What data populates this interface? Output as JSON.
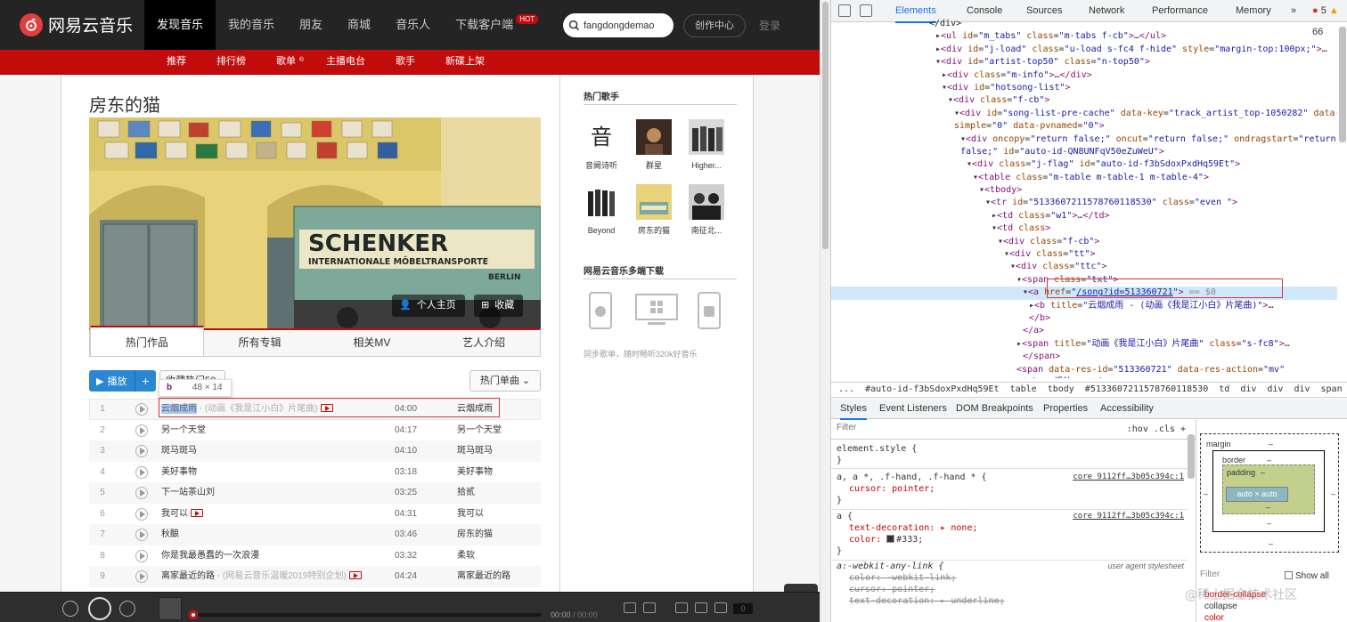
{
  "site": {
    "logo_text": "网易云音乐",
    "nav": [
      "发现音乐",
      "我的音乐",
      "朋友",
      "商城",
      "音乐人",
      "下载客户端"
    ],
    "hot_badge": "HOT",
    "search_value": "fangdongdemao",
    "creator_label": "创作中心",
    "login_label": "登录",
    "subnav": [
      "推荐",
      "排行榜",
      "歌单",
      "主播电台",
      "歌手",
      "新碟上架"
    ],
    "subnav_mark": "®"
  },
  "artist": {
    "name": "房东的猫",
    "banner_sign_line1": "SCHENKER",
    "banner_sign_line2": "INTERNATIONALE MÖBELTRANSPORTE",
    "banner_sign_line3": "BERLIN",
    "homepage_label": "个人主页",
    "collect_label": "收藏",
    "tabs": [
      "热门作品",
      "所有专辑",
      "相关MV",
      "艺人介绍"
    ],
    "play_label": "播放",
    "add_label": "+",
    "fav_label": "收藏热门50",
    "tooltip_tag": "b",
    "tooltip_dims": "48 × 14",
    "hot_select_label": "热门单曲"
  },
  "songs": [
    {
      "num": "1",
      "title": "云烟成雨",
      "alias": " - (动画《我是江小白》片尾曲)",
      "mv": true,
      "duration": "04:00",
      "album": "云烟成雨"
    },
    {
      "num": "2",
      "title": "另一个天堂",
      "alias": "",
      "mv": false,
      "duration": "04:17",
      "album": "另一个天堂"
    },
    {
      "num": "3",
      "title": "斑马斑马",
      "alias": "",
      "mv": false,
      "duration": "04:10",
      "album": "斑马斑马"
    },
    {
      "num": "4",
      "title": "美好事物",
      "alias": "",
      "mv": false,
      "duration": "03:18",
      "album": "美好事物"
    },
    {
      "num": "5",
      "title": "下一站茶山刘",
      "alias": "",
      "mv": false,
      "duration": "03:25",
      "album": "拾贰"
    },
    {
      "num": "6",
      "title": "我可以",
      "alias": "",
      "mv": true,
      "duration": "04:31",
      "album": "我可以"
    },
    {
      "num": "7",
      "title": "秋酿",
      "alias": "",
      "mv": false,
      "duration": "03:46",
      "album": "房东的猫"
    },
    {
      "num": "8",
      "title": "你是我最愚蠢的一次浪漫",
      "alias": "",
      "mv": false,
      "duration": "03:32",
      "album": "柔软"
    },
    {
      "num": "9",
      "title": "离家最近的路",
      "alias": " - (网易云音乐温暖2019特别企划)",
      "mv": true,
      "duration": "04:24",
      "album": "离家最近的路"
    }
  ],
  "sidebar": {
    "hot_artists_title": "热门歌手",
    "artists": [
      "音阙诗听",
      "群星",
      "Higher...",
      "Beyond",
      "房东的猫",
      "南征北..."
    ],
    "download_title": "网易云音乐多端下载",
    "download_desc": "同步歌单，随时畅听320k好音乐"
  },
  "player": {
    "time_current": "00:00",
    "time_total": "00:00",
    "playlist_count": "0"
  },
  "devtools": {
    "tabs": [
      "Elements",
      "Console",
      "Sources",
      "Network",
      "Performance",
      "Memory"
    ],
    "more": "»",
    "errors": "5",
    "warnings": "66",
    "dom_lines": [
      {
        "indent": 0,
        "html": "<span class='c'>&lt;/div&gt;</span>"
      },
      {
        "indent": 1,
        "html": "▸<span class='t'>&lt;ul</span> <span class='a'>id</span>=<span class='v'>\"m_tabs\"</span> <span class='a'>class</span>=<span class='v'>\"m-tabs f-cb\"</span><span class='t'>&gt;</span>…<span class='t'>&lt;/ul&gt;</span>"
      },
      {
        "indent": 1,
        "html": "▸<span class='t'>&lt;div</span> <span class='a'>id</span>=<span class='v'>\"j-load\"</span> <span class='a'>class</span>=<span class='v'>\"u-load s-fc4 f-hide\"</span> <span class='a'>style</span>=<span class='v'>\"margin-top:100px;\"</span><span class='t'>&gt;</span>…"
      },
      {
        "indent": 1,
        "html": "▾<span class='t'>&lt;div</span> <span class='a'>id</span>=<span class='v'>\"artist-top50\"</span> <span class='a'>class</span>=<span class='v'>\"n-top50\"</span><span class='t'>&gt;</span>"
      },
      {
        "indent": 2,
        "html": "▸<span class='t'>&lt;div</span> <span class='a'>class</span>=<span class='v'>\"m-info\"</span><span class='t'>&gt;</span>…<span class='t'>&lt;/div&gt;</span>"
      },
      {
        "indent": 2,
        "html": "▾<span class='t'>&lt;div</span> <span class='a'>id</span>=<span class='v'>\"hotsong-list\"</span><span class='t'>&gt;</span>"
      },
      {
        "indent": 3,
        "html": "▾<span class='t'>&lt;div</span> <span class='a'>class</span>=<span class='v'>\"f-cb\"</span><span class='t'>&gt;</span>"
      },
      {
        "indent": 4,
        "html": "▾<span class='t'>&lt;div</span> <span class='a'>id</span>=<span class='v'>\"song-list-pre-cache\"</span> <span class='a'>data-key</span>=<span class='v'>\"track_artist_top-1050282\"</span> <span class='a'>data-</span>"
      },
      {
        "indent": 4,
        "html": "<span class='a'>simple</span>=<span class='v'>\"0\"</span> <span class='a'>data-pvnamed</span>=<span class='v'>\"0\"</span><span class='t'>&gt;</span>"
      },
      {
        "indent": 5,
        "html": "▾<span class='t'>&lt;div</span> <span class='a'>oncopy</span>=<span class='v'>\"return false;\"</span> <span class='a'>oncut</span>=<span class='v'>\"return false;\"</span> <span class='a'>ondragstart</span>=<span class='v'>\"return</span>"
      },
      {
        "indent": 5,
        "html": "<span class='v'>false;\"</span> <span class='a'>id</span>=<span class='v'>\"auto-id-QN8UNFqV50eZuWeU\"</span><span class='t'>&gt;</span>"
      },
      {
        "indent": 6,
        "html": "▾<span class='t'>&lt;div</span> <span class='a'>class</span>=<span class='v'>\"j-flag\"</span> <span class='a'>id</span>=<span class='v'>\"auto-id-f3bSdoxPxdHq59Et\"</span><span class='t'>&gt;</span>"
      },
      {
        "indent": 7,
        "html": "▾<span class='t'>&lt;table</span> <span class='a'>class</span>=<span class='v'>\"m-table m-table-1 m-table-4\"</span><span class='t'>&gt;</span>"
      },
      {
        "indent": 8,
        "html": "▾<span class='t'>&lt;tbody&gt;</span>"
      },
      {
        "indent": 9,
        "html": "▾<span class='t'>&lt;tr</span> <span class='a'>id</span>=<span class='v'>\"5133607211578760118530\"</span> <span class='a'>class</span>=<span class='v'>\"even \"</span><span class='t'>&gt;</span>"
      },
      {
        "indent": 10,
        "html": "▸<span class='t'>&lt;td</span> <span class='a'>class</span>=<span class='v'>\"w1\"</span><span class='t'>&gt;</span>…<span class='t'>&lt;/td&gt;</span>"
      },
      {
        "indent": 10,
        "html": "▾<span class='t'>&lt;td</span> <span class='a'>class</span><span class='t'>&gt;</span>"
      },
      {
        "indent": 11,
        "html": "▾<span class='t'>&lt;div</span> <span class='a'>class</span>=<span class='v'>\"f-cb\"</span><span class='t'>&gt;</span>"
      },
      {
        "indent": 12,
        "html": "▾<span class='t'>&lt;div</span> <span class='a'>class</span>=<span class='v'>\"tt\"</span><span class='t'>&gt;</span>"
      },
      {
        "indent": 13,
        "html": "▾<span class='t'>&lt;div</span> <span class='a'>class</span>=<span class='v'>\"ttc\"</span><span class='t'>&gt;</span>"
      },
      {
        "indent": 14,
        "html": "▾<span class='t'>&lt;span</span> <span class='a'>class</span>=<span class='v'>\"txt\"</span><span class='t'>&gt;</span>"
      },
      {
        "indent": 15,
        "sel": true,
        "html": "▾<span class='t'>&lt;a</span> <span class='a'>href</span>=<span class='v'>\"</span><span class='lnk'>/song?id=513360721</span><span class='v'>\"</span><span class='t'>&gt;</span> <span class='dim'>== $0</span>"
      },
      {
        "indent": 16,
        "html": "▸<span class='t'>&lt;b</span> <span class='a'>title</span>=<span class='v'>\"云烟成雨 - (动画《我是江小白》片尾曲)\"</span><span class='t'>&gt;</span>…"
      },
      {
        "indent": 16,
        "html": "<span class='t'>&lt;/b&gt;</span>"
      },
      {
        "indent": 15,
        "html": "<span class='t'>&lt;/a&gt;</span>"
      },
      {
        "indent": 14,
        "html": "▸<span class='t'>&lt;span</span> <span class='a'>title</span>=<span class='v'>\"动画《我是江小白》片尾曲\"</span> <span class='a'>class</span>=<span class='v'>\"s-fc8\"</span><span class='t'>&gt;</span>…"
      },
      {
        "indent": 15,
        "html": "<span class='t'>&lt;/span&gt;</span>"
      },
      {
        "indent": 14,
        "html": "<span class='t'>&lt;span</span> <span class='a'>data-res-id</span>=<span class='v'>\"513360721\"</span> <span class='a'>data-res-action</span>=<span class='v'>\"mv\"</span>"
      },
      {
        "indent": 14,
        "html": "<span class='a'>title</span>=<span class='v'>\"播放mv\"</span> <span class='a'>class</span>=<span class='v'>\"mv\"</span><span class='t'>&gt;</span>MV<span class='t'>&lt;/span&gt;</span>"
      }
    ],
    "dom_gutter": "...",
    "breadcrumbs": [
      "...",
      "#auto-id-f3bSdoxPxdHq59Et",
      "table",
      "tbody",
      "#5133607211578760118530",
      "td",
      "div",
      "div",
      "div",
      "span",
      "a"
    ],
    "sub_tabs": [
      "Styles",
      "Event Listeners",
      "DOM Breakpoints",
      "Properties",
      "Accessibility"
    ],
    "filter_placeholder": "Filter",
    "filter_tools": ":hov  .cls  +",
    "rules": {
      "element_style": "element.style {",
      "close": "}",
      "r1_sel": "a, a *, .f-hand, .f-hand * {",
      "r1_src": "core_9112ff…3b05c394c:1",
      "r1_prop": "cursor: pointer;",
      "r2_sel": "a {",
      "r2_src": "core_9112ff…3b05c394c:1",
      "r2_p1": "text-decoration: ▸ none;",
      "r2_p2": "color: ",
      "r2_p2_val": "#333;",
      "r3_sel": "a:-webkit-any-link {",
      "r3_src": "user agent stylesheet",
      "r3_p1": "color: -webkit-link;",
      "r3_p2": "cursor: pointer;",
      "r3_p3": "text-decoration: ▸ underline;"
    },
    "box_model": {
      "margin": "margin",
      "border": "border",
      "padding": "padding",
      "dash": "–",
      "content": "auto × auto"
    },
    "filter2_placeholder": "Filter",
    "show_all": "Show all",
    "computed_prop": "border-collapse",
    "computed_val": "collapse",
    "computed_prop2": "color",
    "watermark": "@稀土掘金技术社区"
  },
  "colors": {
    "brand_red": "#c20c0c",
    "top_bg": "#242424",
    "play_blue": "#2b87d1",
    "devtools_accent": "#1a73e8"
  }
}
